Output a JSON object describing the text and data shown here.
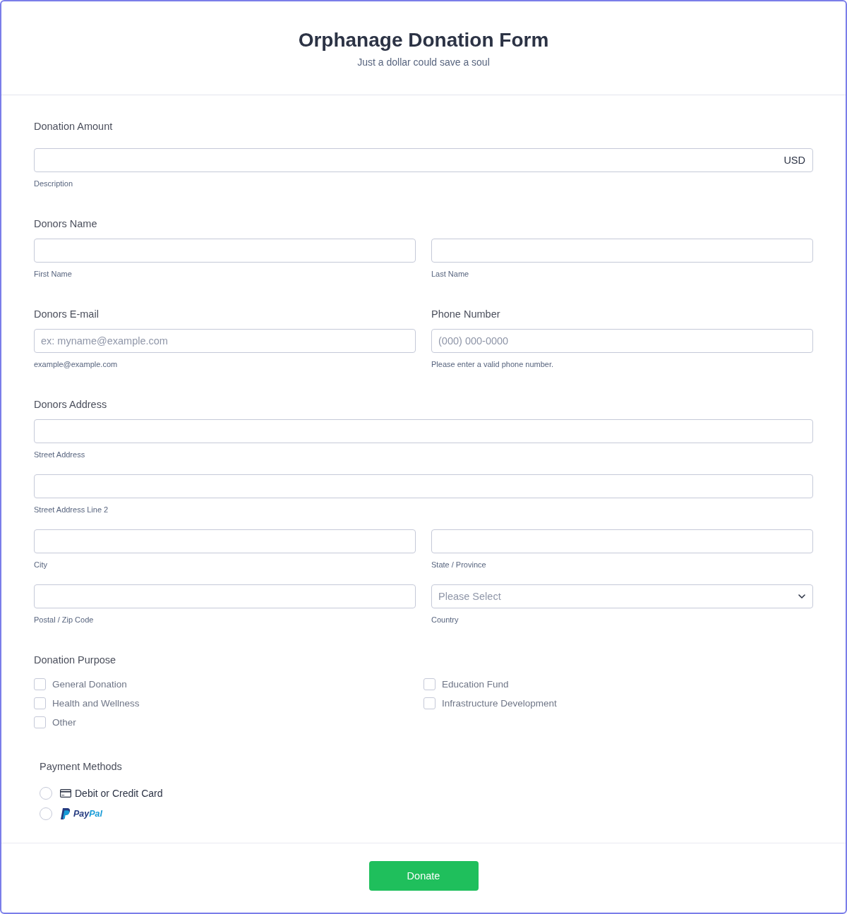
{
  "header": {
    "title": "Orphanage Donation Form",
    "subtitle": "Just a dollar could save a soul"
  },
  "donation_amount": {
    "label": "Donation Amount",
    "currency": "USD",
    "sublabel": "Description"
  },
  "donors_name": {
    "label": "Donors Name",
    "fields": [
      {
        "sublabel": "First Name"
      },
      {
        "sublabel": "Last Name"
      }
    ]
  },
  "contact": [
    {
      "label": "Donors E-mail",
      "placeholder": "ex: myname@example.com",
      "sublabel": "example@example.com"
    },
    {
      "label": "Phone Number",
      "placeholder": "(000) 000-0000",
      "sublabel": "Please enter a valid phone number."
    }
  ],
  "address": {
    "label": "Donors Address",
    "rows": [
      [
        {
          "kind": "text",
          "sublabel": "Street Address"
        }
      ],
      [
        {
          "kind": "text",
          "sublabel": "Street Address Line 2"
        }
      ],
      [
        {
          "kind": "text",
          "sublabel": "City"
        },
        {
          "kind": "text",
          "sublabel": "State / Province"
        }
      ],
      [
        {
          "kind": "text",
          "sublabel": "Postal / Zip Code"
        },
        {
          "kind": "select",
          "placeholder": "Please Select",
          "sublabel": "Country"
        }
      ]
    ]
  },
  "donation_purpose": {
    "label": "Donation Purpose",
    "options": [
      {
        "label": "General Donation",
        "checked": false
      },
      {
        "label": "Education Fund",
        "checked": false
      },
      {
        "label": "Health and Wellness",
        "checked": false
      },
      {
        "label": "Infrastructure Development",
        "checked": false
      },
      {
        "label": "Other",
        "checked": false
      }
    ]
  },
  "payment_methods": {
    "label": "Payment Methods",
    "options": [
      {
        "kind": "card",
        "label": "Debit or Credit Card",
        "selected": false
      },
      {
        "kind": "paypal",
        "label_parts": [
          "Pay",
          "Pal"
        ],
        "selected": false
      }
    ]
  },
  "submit_button": "Donate"
}
